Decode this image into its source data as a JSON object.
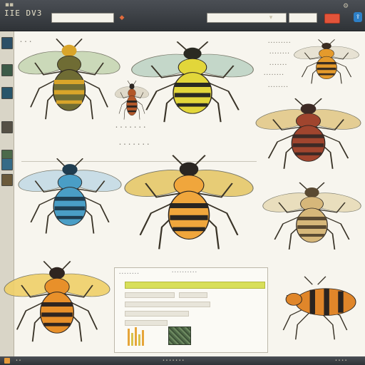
{
  "app": {
    "title": "IIE DV3"
  },
  "toolbar": {
    "search_value": "",
    "field_a_value": "",
    "field_b_value": "",
    "icons": [
      "menu-icon",
      "close-icon",
      "square-icon",
      "window-icon"
    ]
  },
  "rail": {
    "thumbnails": [
      {
        "name": "thumb-bee",
        "color": "#2c4f66"
      },
      {
        "name": "thumb-wasp",
        "color": "#3d5b48"
      },
      {
        "name": "thumb-moth",
        "color": "#28556a"
      },
      {
        "name": "thumb-beetle",
        "color": "#555045"
      },
      {
        "name": "thumb-ant",
        "color": "#4c6a4a"
      },
      {
        "name": "thumb-fly",
        "color": "#366b86"
      },
      {
        "name": "thumb-hornet",
        "color": "#6b5a3a"
      }
    ]
  },
  "captions": {
    "top_left": "• • •",
    "mid": "• • • • • • •",
    "mid2": "• • • • • • •"
  },
  "legend_lines": [
    "• • • • • • • • •",
    "• • • • • • • •",
    "• • • • • • •",
    "• • • • • • • •",
    "• • • • • • • •"
  ],
  "specimens": [
    {
      "name": "honeybee-specimen",
      "body": "#6f6c34",
      "stripe": "#d9a52a",
      "wing": "#c7d7b4"
    },
    {
      "name": "small-wasp-specimen",
      "body": "#b2582a",
      "stripe": "#2b2622",
      "wing": "#ddd6c6"
    },
    {
      "name": "yellowjacket-specimen",
      "body": "#e2d63a",
      "stripe": "#2a2a22",
      "wing": "#bfd4c6"
    },
    {
      "name": "hornet-specimen",
      "body": "#e49a2c",
      "stripe": "#3a2d22",
      "wing": "#e6e1d1"
    },
    {
      "name": "orange-wasp-specimen",
      "body": "#a0452e",
      "stripe": "#3d2a25",
      "wing": "#e3c98a"
    },
    {
      "name": "blue-fly-specimen",
      "body": "#4a9ec6",
      "stripe": "#1f3d50",
      "wing": "#c5dbe6"
    },
    {
      "name": "golden-bee-specimen",
      "body": "#f0a63c",
      "stripe": "#2a2622",
      "wing": "#e6c86a"
    },
    {
      "name": "pale-wasp-specimen",
      "body": "#d6b77a",
      "stripe": "#5a4a32",
      "wing": "#e8dcb8"
    },
    {
      "name": "tiger-beetle-specimen",
      "body": "#e8902a",
      "stripe": "#2f2520",
      "wing": "#f0d068"
    },
    {
      "name": "crawling-wasp-specimen",
      "body": "#e0862a",
      "stripe": "#2a2420",
      "wing": "#e6e0d0"
    }
  ],
  "panel": {
    "header_left": "• • • • • • • •",
    "header_right": "• • • • • • • • • •"
  },
  "bottombar": {
    "left": "• •",
    "center": "• • • • • • •",
    "right": "• • • •"
  },
  "colors": {
    "accent": "#e2543a",
    "toolbar": "#3a3e43",
    "highlight": "#d8df5a"
  }
}
